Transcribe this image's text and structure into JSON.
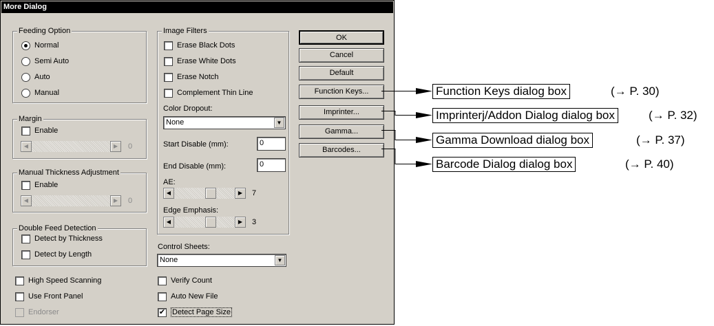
{
  "dialog": {
    "title": "More Dialog",
    "feeding_option": {
      "label": "Feeding Option",
      "options": [
        "Normal",
        "Semi Auto",
        "Auto",
        "Manual"
      ],
      "selected": "Normal"
    },
    "margin": {
      "label": "Margin",
      "enable_label": "Enable",
      "value": "0"
    },
    "manual_thickness": {
      "label": "Manual Thickness Adjustment",
      "enable_label": "Enable",
      "value": "0"
    },
    "double_feed": {
      "label": "Double Feed Detection",
      "by_thickness": "Detect by Thickness",
      "by_length": "Detect by Length"
    },
    "high_speed": "High Speed Scanning",
    "use_front_panel": "Use Front Panel",
    "endorser": "Endorser",
    "image_filters": {
      "label": "Image Filters",
      "erase_black_dots": "Erase Black Dots",
      "erase_white_dots": "Erase White Dots",
      "erase_notch": "Erase Notch",
      "complement_thin_line": "Complement Thin Line"
    },
    "color_dropout": {
      "label": "Color Dropout:",
      "value": "None"
    },
    "start_disable": {
      "label": "Start Disable (mm):",
      "value": "0"
    },
    "end_disable": {
      "label": "End Disable (mm):",
      "value": "0"
    },
    "ae": {
      "label": "AE:",
      "value": "7"
    },
    "edge_emphasis": {
      "label": "Edge Emphasis:",
      "value": "3"
    },
    "control_sheets": {
      "label": "Control Sheets:",
      "value": "None"
    },
    "verify_count": "Verify Count",
    "auto_new_file": "Auto New File",
    "detect_page_size": {
      "label": "Detect Page Size",
      "checked": true
    },
    "buttons": {
      "ok": "OK",
      "cancel": "Cancel",
      "default": "Default",
      "function_keys": "Function Keys...",
      "imprinter": "Imprinter...",
      "gamma": "Gamma...",
      "barcodes": "Barcodes..."
    }
  },
  "callouts": [
    {
      "label": "Function Keys dialog box",
      "ref": "(→ P. 30)"
    },
    {
      "label": "Imprinterj/Addon Dialog dialog box",
      "ref": "(→ P. 32)"
    },
    {
      "label": "Gamma Download dialog box",
      "ref": "(→ P. 37)"
    },
    {
      "label": "Barcode Dialog dialog box",
      "ref": "(→ P. 40)"
    }
  ],
  "icons": {
    "checkmark": "✔",
    "arrow_left": "◀",
    "arrow_right": "▶",
    "arrow_down": "▼"
  }
}
